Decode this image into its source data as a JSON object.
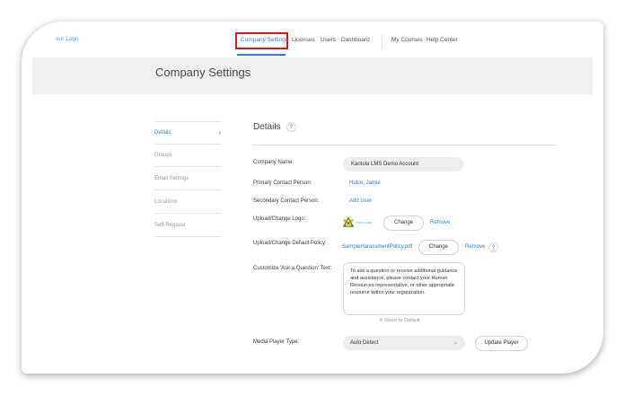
{
  "nav": {
    "logo": "our Logo",
    "items": [
      "Company Settings",
      "Licenses",
      "Users",
      "Dashboard"
    ],
    "right_items": [
      "My Courses",
      "Help Center"
    ]
  },
  "page_title": "Company Settings",
  "sidebar": {
    "items": [
      "Details",
      "Groups",
      "Email Settings",
      "Locations",
      "Self-Register"
    ],
    "active_chevron": "›"
  },
  "details": {
    "title": "Details",
    "help": "?",
    "company_name_label": "Company Name:",
    "company_name_value": "Kantola LMS Demo Account",
    "primary_contact_label": "Primary Contact Person:",
    "primary_contact_value": "Hulce, Jamie",
    "secondary_contact_label": "Secondary Contact Person:",
    "secondary_contact_link": "Add User",
    "logo_label": "Upload/Change Logo:",
    "logo_preview_text": "Your Logo",
    "logo_change": "Change",
    "logo_remove": "Remove",
    "policy_label": "Upload/Change Default Policy:",
    "policy_file": "SampleHarassmentPolicy.pdf",
    "policy_change": "Change",
    "policy_remove": "Remove",
    "ask_label": "Customize 'Ask a Question' Text:",
    "ask_text": "To ask a question or receive additional guidance and assistance, please contact your Human Resources representative, or other appropriate resource within your organization.",
    "reset_label": "✕  Reset to Default",
    "media_label": "Media Player Type:",
    "media_value": "Auto Detect",
    "media_chevron": "⌄",
    "update_player": "Update Player"
  },
  "colors": {
    "accent": "#2a7fd4",
    "highlight": "#d8141c",
    "header_band": "#eeeff1"
  }
}
